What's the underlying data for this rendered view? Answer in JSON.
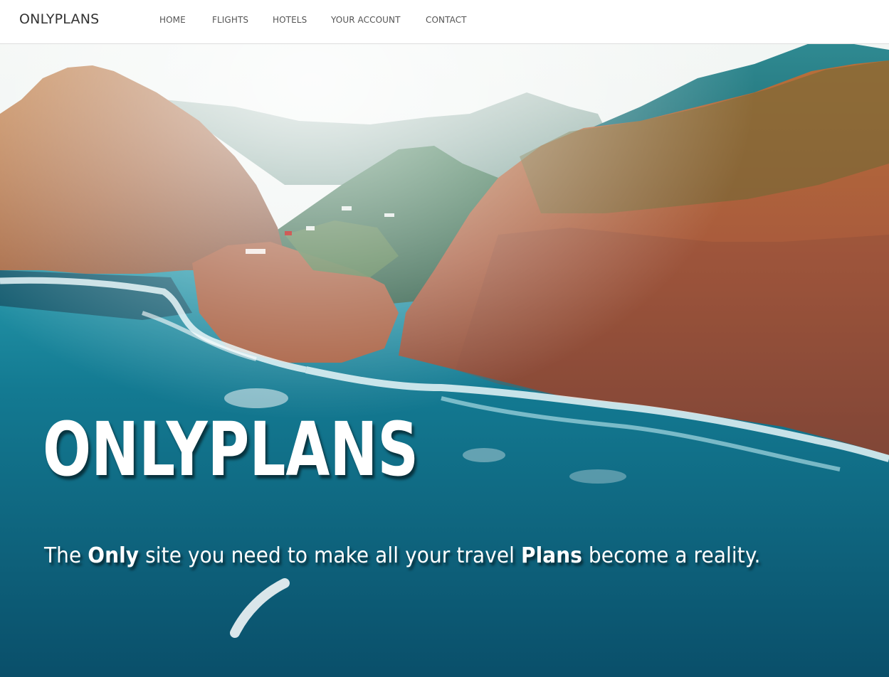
{
  "navbar": {
    "brand": "ONLYPLANS",
    "items": [
      {
        "label": "HOME"
      },
      {
        "label": "FLIGHTS"
      },
      {
        "label": "HOTELS"
      },
      {
        "label": "YOUR ACCOUNT"
      },
      {
        "label": "CONTACT"
      }
    ]
  },
  "hero": {
    "title": "ONLYPLANS",
    "tagline": {
      "part1": "The ",
      "emphasis1": "Only",
      "part2": " site you need to make all your travel ",
      "emphasis2": "Plans",
      "part3": " become a reality."
    },
    "background": "coastal-cliffs-photo"
  },
  "colors": {
    "navbar_bg": "#ffffff",
    "nav_text": "#555555",
    "brand_text": "#333333",
    "hero_text": "#ffffff",
    "ocean": "#0e6d85",
    "cliff": "#b8673a"
  }
}
